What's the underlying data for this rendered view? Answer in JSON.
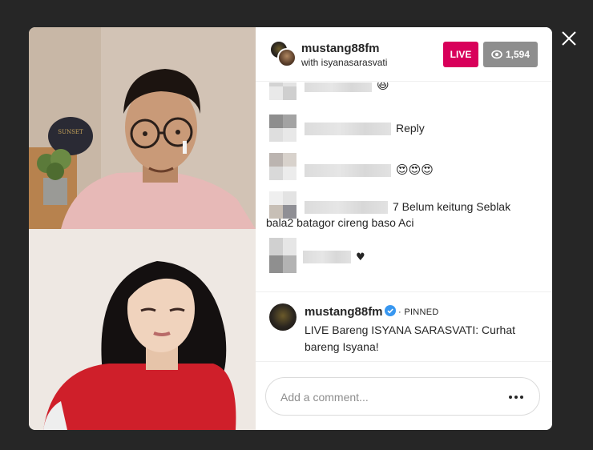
{
  "stream": {
    "host": "mustang88fm",
    "with_label": "with isyanasarasvati",
    "live_label": "LIVE",
    "viewer_count": "1,594"
  },
  "comments": [
    {
      "text": "",
      "emoji": "😆"
    },
    {
      "text": "Reply",
      "emoji": ""
    },
    {
      "text": "",
      "emoji": "😍😍😍"
    },
    {
      "text": "7 Belum keitung Seblak",
      "text2": "bala2 batagor cireng baso Aci",
      "emoji": ""
    },
    {
      "text": "",
      "emoji": "♥"
    }
  ],
  "pinned": {
    "name": "mustang88fm",
    "tag": "· PINNED",
    "text": "LIVE Bareng ISYANA SARASVATI: Curhat bareng Isyana!"
  },
  "composer": {
    "placeholder": "Add a comment..."
  },
  "colors": {
    "live": "#d8005a",
    "viewer_badge": "#8e8e8e",
    "verified": "#3897f0",
    "backdrop": "#262626"
  },
  "icons": {
    "close": "close-icon",
    "eye": "eye-icon",
    "verified": "verified-badge-icon",
    "more": "more-horizontal-icon"
  }
}
